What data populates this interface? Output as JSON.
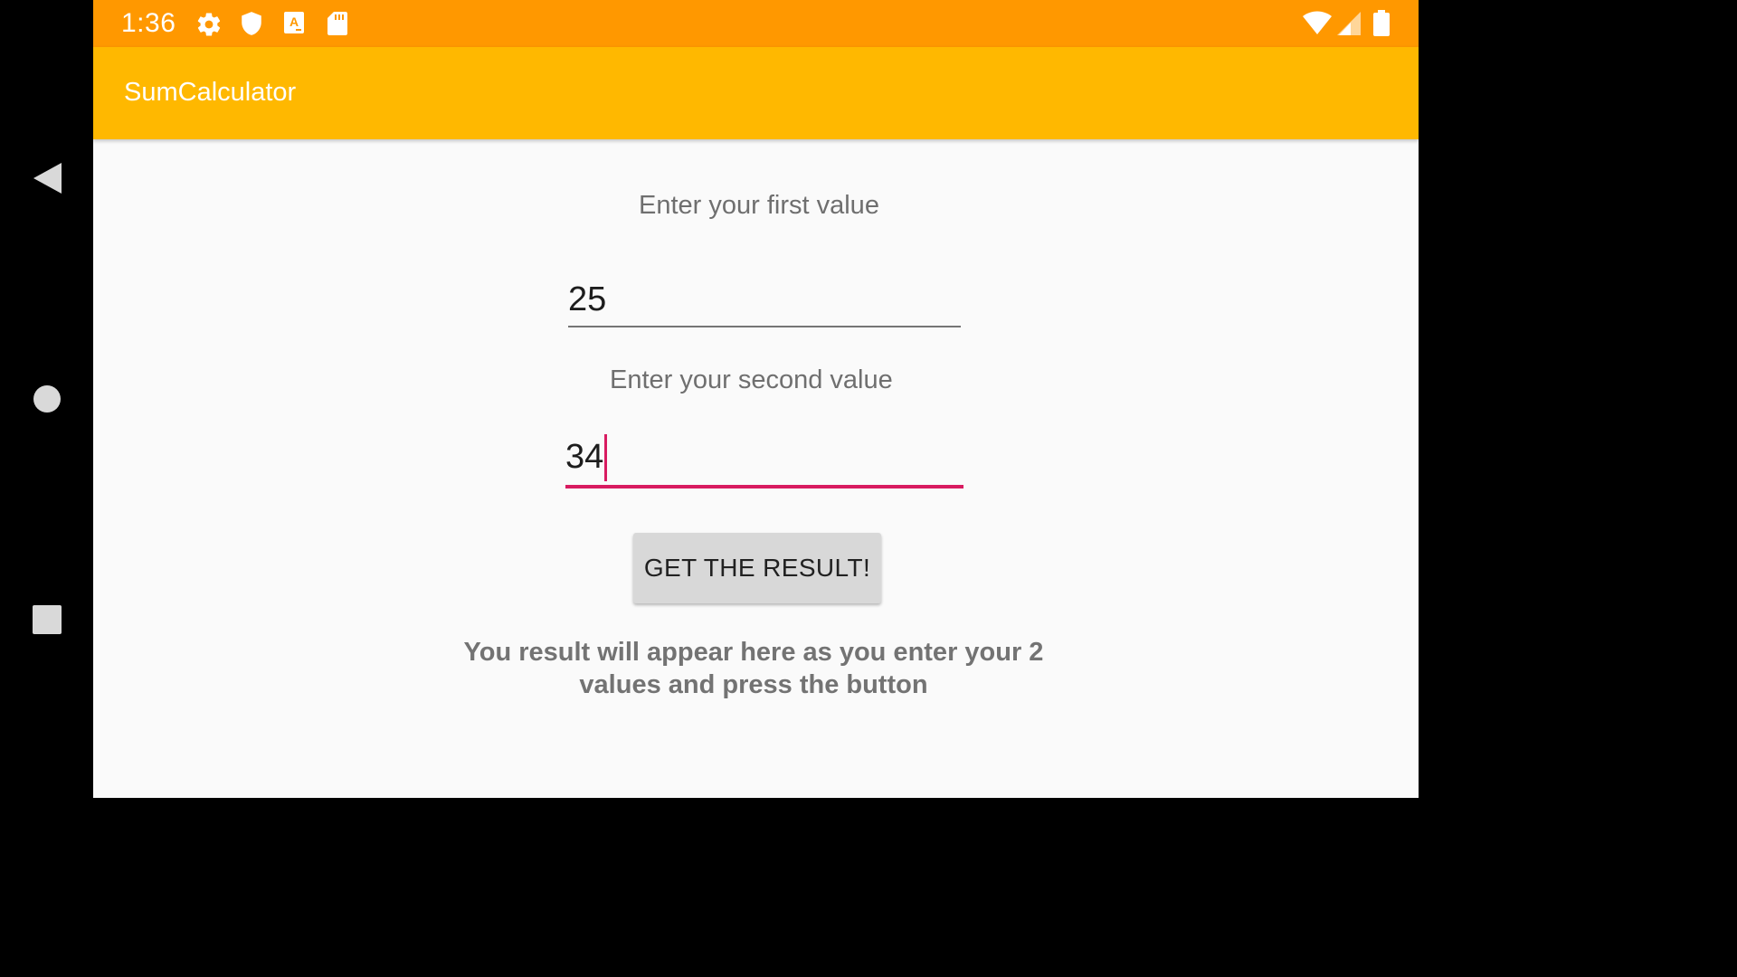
{
  "status_bar": {
    "time": "1:36",
    "icons": [
      "gear-icon",
      "shield-icon",
      "font-a-icon",
      "sd-card-icon",
      "wifi-icon",
      "cell-signal-icon",
      "battery-icon"
    ],
    "color": "#ff9800"
  },
  "app_bar": {
    "title": "SumCalculator",
    "color": "#ffb800"
  },
  "form": {
    "first_label": "Enter your first value",
    "first_value": "25",
    "second_label": "Enter your second value",
    "second_value": "34",
    "focused_color": "#d81b60",
    "button_label": "GET THE RESULT!",
    "result_text": "You result will appear here as you enter your 2 values and press the button"
  },
  "nav": {
    "buttons": [
      "back-icon",
      "home-icon",
      "recents-icon"
    ]
  }
}
